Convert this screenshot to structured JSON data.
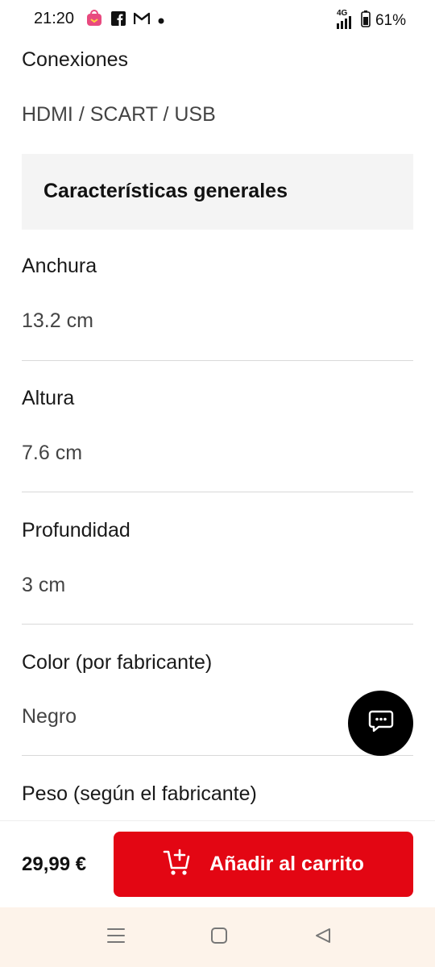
{
  "status_bar": {
    "time": "21:20",
    "network": "4G",
    "battery": "61%"
  },
  "specs_top": {
    "connections_label": "Conexiones",
    "connections_value": "HDMI / SCART / USB"
  },
  "section": {
    "title": "Características generales"
  },
  "specs": [
    {
      "label": "Anchura",
      "value": "13.2 cm"
    },
    {
      "label": "Altura",
      "value": "7.6 cm"
    },
    {
      "label": "Profundidad",
      "value": "3 cm"
    },
    {
      "label": "Color (por fabricante)",
      "value": "Negro"
    },
    {
      "label": "Peso (según el fabricante)",
      "value": ""
    }
  ],
  "bottom_bar": {
    "price": "29,99 €",
    "cart_button_label": "Añadir al carrito",
    "accent_color": "#e30613"
  },
  "icons": {
    "chat": "chat-bubble-icon",
    "cart": "add-to-cart-icon"
  }
}
